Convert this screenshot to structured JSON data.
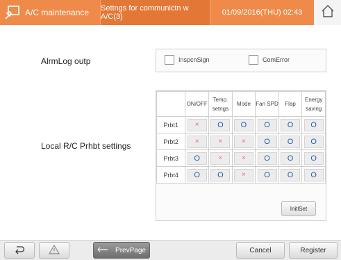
{
  "header": {
    "app_title": "A/C maintenance",
    "screen_title": "Settngs for communictn w A/C(3)",
    "datetime": "01/09/2016(THU) 02:43"
  },
  "alarm_log": {
    "label": "AlrmLog outp",
    "options": [
      {
        "label": "InspcnSign",
        "checked": false
      },
      {
        "label": "ComError",
        "checked": false
      }
    ]
  },
  "prohibit": {
    "label": "Local R/C Prhbt settings",
    "columns": [
      "ON/OFF",
      "Temp. setngs",
      "Mode",
      "Fan SPD",
      "Flap",
      "Energy saving"
    ],
    "rows": [
      {
        "label": "Prbt1",
        "values": [
          "x",
          "o",
          "o",
          "o",
          "o",
          "o"
        ]
      },
      {
        "label": "Prbt2",
        "values": [
          "x",
          "x",
          "x",
          "o",
          "o",
          "o"
        ]
      },
      {
        "label": "Prbt3",
        "values": [
          "o",
          "x",
          "x",
          "o",
          "o",
          "o"
        ]
      },
      {
        "label": "Prbt4",
        "values": [
          "o",
          "o",
          "x",
          "o",
          "o",
          "o"
        ]
      }
    ],
    "init_label": "InitlSet"
  },
  "footer": {
    "prev_label": "PrevPage",
    "cancel_label": "Cancel",
    "register_label": "Register"
  },
  "marks": {
    "o": "O",
    "x": "×"
  },
  "colors": {
    "accent": "#ef8a4a",
    "accent_dark": "#e37836",
    "mark_o": "#1f5fa8",
    "mark_x": "#e07070"
  },
  "icons": [
    "ac-maintenance-icon",
    "home-icon",
    "back-icon",
    "warning-icon",
    "arrow-left-icon"
  ]
}
